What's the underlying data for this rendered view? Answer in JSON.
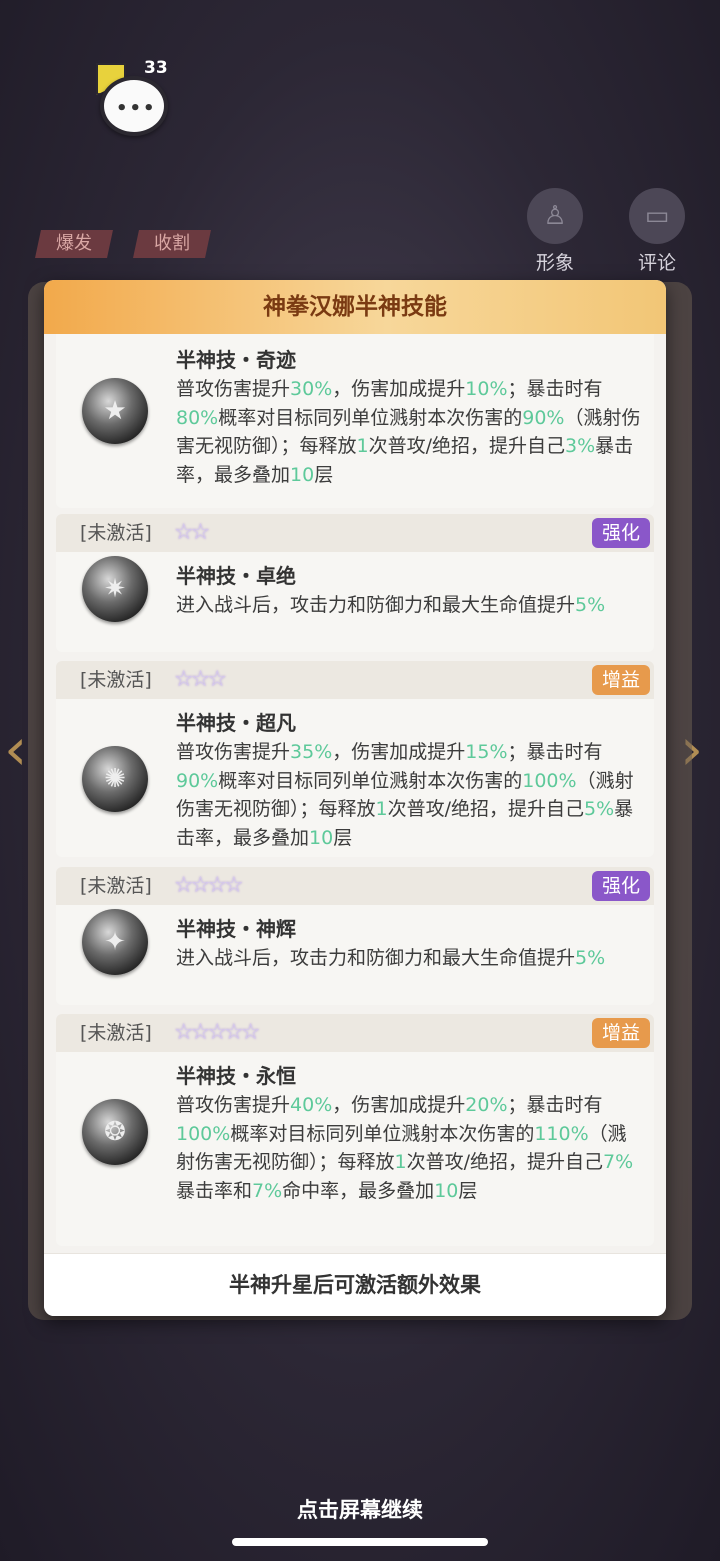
{
  "chat": {
    "count": "33",
    "icon": "chat-bubble-icon"
  },
  "tags": [
    "爆发",
    "收割"
  ],
  "side_buttons": {
    "portrait": "形象",
    "comment": "评论"
  },
  "panel": {
    "title": "神拳汉娜半神技能",
    "footer": "半神升星后可激活额外效果"
  },
  "skills": [
    {
      "status": "",
      "stars": "",
      "badge": "",
      "title": "半神技・奇迹",
      "desc": [
        [
          "普攻伤害提升",
          ""
        ],
        [
          "30%",
          "hl"
        ],
        [
          "，伤害加成提升",
          ""
        ],
        [
          "10%",
          "hl"
        ],
        [
          "；暴击时有",
          ""
        ],
        [
          "80%",
          "hl"
        ],
        [
          "概率对目标同列单位溅射本次伤害的",
          ""
        ],
        [
          "90%",
          "hl"
        ],
        [
          "（溅射伤害无视防御）；每释放",
          ""
        ],
        [
          "1",
          "hl"
        ],
        [
          "次普攻/绝招，提升自己",
          ""
        ],
        [
          "3%",
          "hl"
        ],
        [
          "暴击率，最多叠加",
          ""
        ],
        [
          "10",
          "hl"
        ],
        [
          "层",
          ""
        ]
      ]
    },
    {
      "status": "[未激活]",
      "stars": "☆☆",
      "badge": "强化",
      "title": "半神技・卓绝",
      "desc": [
        [
          "进入战斗后，攻击力和防御力和最大生命值提升",
          ""
        ],
        [
          "5%",
          "hl"
        ]
      ]
    },
    {
      "status": "[未激活]",
      "stars": "☆☆☆",
      "badge": "增益",
      "title": "半神技・超凡",
      "desc": [
        [
          "普攻伤害提升",
          ""
        ],
        [
          "35%",
          "hl"
        ],
        [
          "，伤害加成提升",
          ""
        ],
        [
          "15%",
          "hl"
        ],
        [
          "；暴击时有",
          ""
        ],
        [
          "90%",
          "hl"
        ],
        [
          "概率对目标同列单位溅射本次伤害的",
          ""
        ],
        [
          "100%",
          "hl"
        ],
        [
          "（溅射伤害无视防御）；每释放",
          ""
        ],
        [
          "1",
          "hl"
        ],
        [
          "次普攻/绝招，提升自己",
          ""
        ],
        [
          "5%",
          "hl"
        ],
        [
          "暴击率，最多叠加",
          ""
        ],
        [
          "10",
          "hl"
        ],
        [
          "层",
          ""
        ]
      ]
    },
    {
      "status": "[未激活]",
      "stars": "☆☆☆☆",
      "badge": "强化",
      "title": "半神技・神辉",
      "desc": [
        [
          "进入战斗后，攻击力和防御力和最大生命值提升",
          ""
        ],
        [
          "5%",
          "hl"
        ]
      ]
    },
    {
      "status": "[未激活]",
      "stars": "☆☆☆☆☆",
      "badge": "增益",
      "title": "半神技・永恒",
      "desc": [
        [
          "普攻伤害提升",
          ""
        ],
        [
          "40%",
          "hl"
        ],
        [
          "，伤害加成提升",
          ""
        ],
        [
          "20%",
          "hl"
        ],
        [
          "；暴击时有",
          ""
        ],
        [
          "100%",
          "hl"
        ],
        [
          "概率对目标同列单位溅射本次伤害的",
          ""
        ],
        [
          "110%",
          "hl"
        ],
        [
          "（溅射伤害无视防御）；每释放",
          ""
        ],
        [
          "1",
          "hl"
        ],
        [
          "次普攻/绝招，提升自己",
          ""
        ],
        [
          "7%",
          "hl"
        ],
        [
          "暴击率和",
          ""
        ],
        [
          "7%",
          "hl"
        ],
        [
          "命中率，最多叠加",
          ""
        ],
        [
          "10",
          "hl"
        ],
        [
          "层",
          ""
        ]
      ]
    }
  ],
  "continue_text": "点击屏幕继续",
  "colors": {
    "highlight": "#5ec99a",
    "badge_purple": "#8a57c9",
    "badge_orange": "#e79a4c",
    "header_gold": "#f2a94b"
  }
}
